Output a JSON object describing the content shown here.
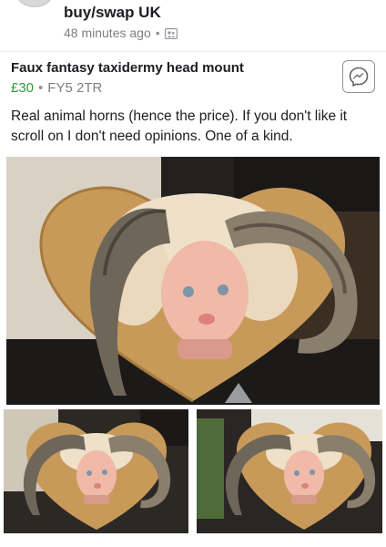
{
  "group": {
    "name": "buy/swap UK",
    "time": "48 minutes ago",
    "privacy_icon": "group-icon"
  },
  "listing": {
    "title": "Faux fantasy taxidermy head mount",
    "price": "£30",
    "location": "FY5 2TR",
    "description": "Real animal horns (hence the price). If you don't like it scroll on I don't need opinions. One of a kind."
  },
  "actions": {
    "message_icon": "messenger-icon"
  },
  "photos": {
    "main_subject": "taxidermy-mount-photo",
    "thumb_subject": "taxidermy-mount-thumbnail"
  },
  "colors": {
    "price_green": "#2e9b38",
    "meta_gray": "#7f7f7f",
    "text": "#1c1e21"
  }
}
